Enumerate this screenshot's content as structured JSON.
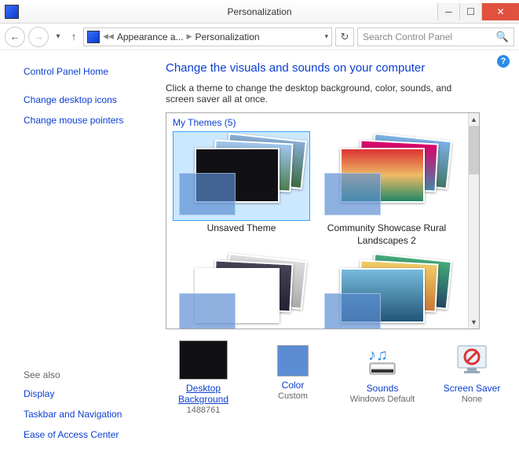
{
  "window": {
    "title": "Personalization"
  },
  "nav": {
    "breadcrumb1": "Appearance a...",
    "breadcrumb2": "Personalization",
    "search_placeholder": "Search Control Panel"
  },
  "left": {
    "home": "Control Panel Home",
    "desktop_icons": "Change desktop icons",
    "mouse_pointers": "Change mouse pointers",
    "see_also": "See also",
    "display": "Display",
    "taskbar": "Taskbar and Navigation",
    "ease": "Ease of Access Center"
  },
  "main": {
    "heading": "Change the visuals and sounds on your computer",
    "subtext": "Click a theme to change the desktop background, color, sounds, and screen saver all at once.",
    "group_label": "My Themes (5)",
    "themes": [
      {
        "name": "Unsaved Theme"
      },
      {
        "name": "Community Showcase Rural Landscapes 2"
      },
      {
        "name": ""
      },
      {
        "name": ""
      }
    ]
  },
  "bottom": {
    "desktop_bg": {
      "label": "Desktop Background",
      "value": "1488761"
    },
    "color": {
      "label": "Color",
      "value": "Custom"
    },
    "sounds": {
      "label": "Sounds",
      "value": "Windows Default"
    },
    "saver": {
      "label": "Screen Saver",
      "value": "None"
    }
  }
}
